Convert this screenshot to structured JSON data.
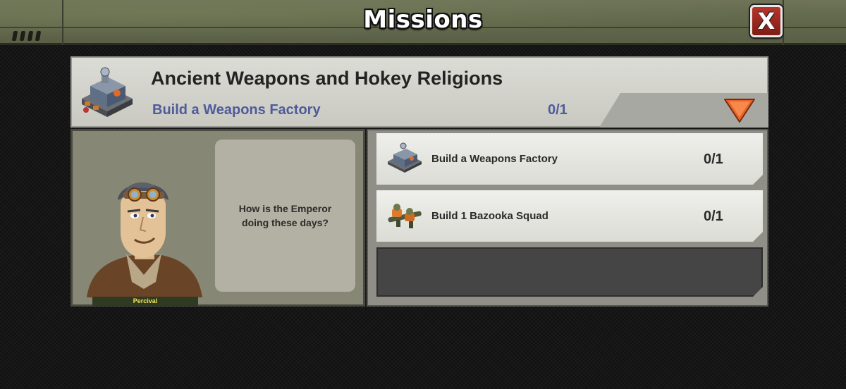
{
  "window": {
    "title": "Missions",
    "close_label": "X"
  },
  "mission": {
    "title": "Ancient Weapons and Hokey Religions",
    "objective": "Build a Weapons Factory",
    "progress": "0/1",
    "icon": "weapons-factory-icon"
  },
  "dialogue": {
    "character_name": "Percival",
    "text": "How is the Emperor doing these days?"
  },
  "tasks": [
    {
      "label": "Build a Weapons Factory",
      "count": "0/1",
      "icon": "weapons-factory-icon"
    },
    {
      "label": "Build 1 Bazooka Squad",
      "count": "0/1",
      "icon": "bazooka-squad-icon"
    }
  ],
  "colors": {
    "accent_blue": "#4d5c9a",
    "close_red": "#b6352b",
    "collapse_orange": "#e8622a",
    "name_yellow": "#f0e35a"
  }
}
